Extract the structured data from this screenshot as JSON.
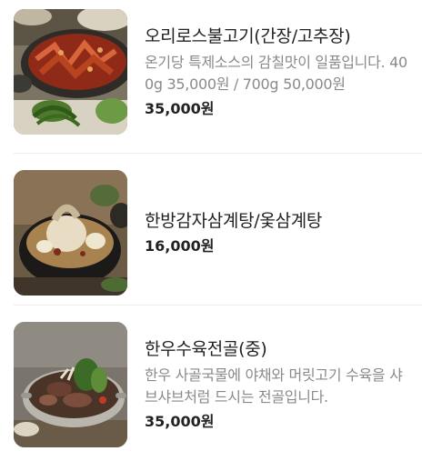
{
  "menu": {
    "items": [
      {
        "name": "오리로스불고기(간장/고추장)",
        "description": "온기당 특제소스의 감칠맛이 일품입니다. 400g 35,000원 / 700g 50,000원",
        "price": "35,000원",
        "image_icon": "spicy-duck-bulgogi-photo"
      },
      {
        "name": "한방감자삼계탕/옻삼계탕",
        "description": "",
        "price": "16,000원",
        "image_icon": "samgyetang-photo"
      },
      {
        "name": "한우수육전골(중)",
        "description": "한우 사골국물에 야채와 머릿고기 수육을 샤브샤브처럼 드시는 전골입니다.",
        "price": "35,000원",
        "image_icon": "beef-hotpot-photo"
      }
    ]
  }
}
